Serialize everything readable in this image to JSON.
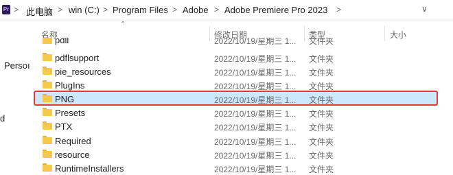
{
  "addressbar": {
    "app_badge": "Pr",
    "crumbs": [
      "此电脑",
      "win (C:)",
      "Program Files",
      "Adobe",
      "Adobe Premiere Pro 2023"
    ],
    "separator": ">",
    "dropdown": "∨"
  },
  "nav": {
    "fragments": [
      "Persoı",
      "d"
    ]
  },
  "columns": {
    "name": "名称",
    "modified": "修改日期",
    "type": "类型",
    "size": "大小"
  },
  "rows": [
    {
      "name": "pdll",
      "modified": "2022/10/19/星期三 1...",
      "type": "文件夹",
      "selected": false
    },
    {
      "name": "pdflsupport",
      "modified": "2022/10/19/星期三 1...",
      "type": "文件夹",
      "selected": false
    },
    {
      "name": "pie_resources",
      "modified": "2022/10/19/星期三 1...",
      "type": "文件夹",
      "selected": false
    },
    {
      "name": "PlugIns",
      "modified": "2022/10/19/星期三 1...",
      "type": "文件夹",
      "selected": false
    },
    {
      "name": "PNG",
      "modified": "2022/10/19/星期三 1...",
      "type": "文件夹",
      "selected": true
    },
    {
      "name": "Presets",
      "modified": "2022/10/19/星期三 1...",
      "type": "文件夹",
      "selected": false
    },
    {
      "name": "PTX",
      "modified": "2022/10/19/星期三 1...",
      "type": "文件夹",
      "selected": false
    },
    {
      "name": "Required",
      "modified": "2022/10/19/星期三 1...",
      "type": "文件夹",
      "selected": false
    },
    {
      "name": "resource",
      "modified": "2022/10/19/星期三 1...",
      "type": "文件夹",
      "selected": false
    },
    {
      "name": "RuntimeInstallers",
      "modified": "2022/10/19/星期三 1...",
      "type": "文件夹",
      "selected": false
    }
  ],
  "colors": {
    "selection": "#cce8ff",
    "highlight_border": "#e53935",
    "folder": "#f5c94c"
  }
}
